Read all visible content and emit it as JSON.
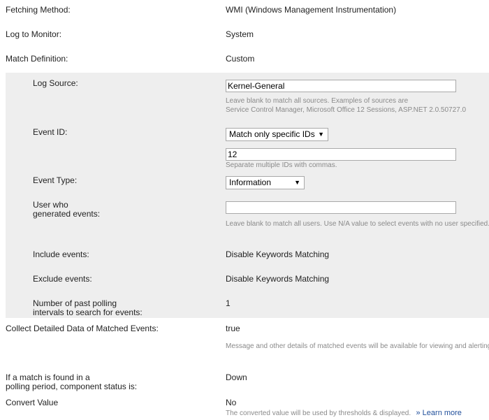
{
  "fetching_method": {
    "label": "Fetching Method:",
    "value": "WMI (Windows Management Instrumentation)"
  },
  "log_to_monitor": {
    "label": "Log to Monitor:",
    "value": "System"
  },
  "match_definition": {
    "label": "Match Definition:",
    "value": "Custom"
  },
  "log_source": {
    "label": "Log Source:",
    "value": "Kernel-General",
    "help_line1": "Leave blank to match all sources. Examples of sources are",
    "help_line2": "Service Control Manager, Microsoft Office 12 Sessions, ASP.NET 2.0.50727.0"
  },
  "event_id": {
    "label": "Event ID:",
    "mode_selected": "Match only specific IDs",
    "value": "12",
    "help": "Separate multiple IDs with commas."
  },
  "event_type": {
    "label": "Event Type:",
    "selected": "Information"
  },
  "user": {
    "label_line1": "User who",
    "label_line2": "generated events:",
    "value": "",
    "help": "Leave blank to match all users. Use N/A value to select events with no user specified."
  },
  "include_events": {
    "label": "Include events:",
    "value": "Disable Keywords Matching"
  },
  "exclude_events": {
    "label": "Exclude events:",
    "value": "Disable Keywords Matching"
  },
  "polling_intervals": {
    "label_line1": "Number of past polling",
    "label_line2": "intervals to search for events:",
    "value": "1"
  },
  "collect_detailed": {
    "label": "Collect Detailed Data of Matched Events:",
    "value": "true",
    "help": "Message and other details of matched events will be available for viewing and alerting."
  },
  "match_status": {
    "label_line1": "If a match is found in a",
    "label_line2": "polling period, component status is:",
    "value": "Down"
  },
  "convert_value": {
    "label": "Convert Value",
    "value": "No",
    "help": "The converted value will be used by thresholds & displayed.",
    "learn_more": "» Learn more"
  }
}
